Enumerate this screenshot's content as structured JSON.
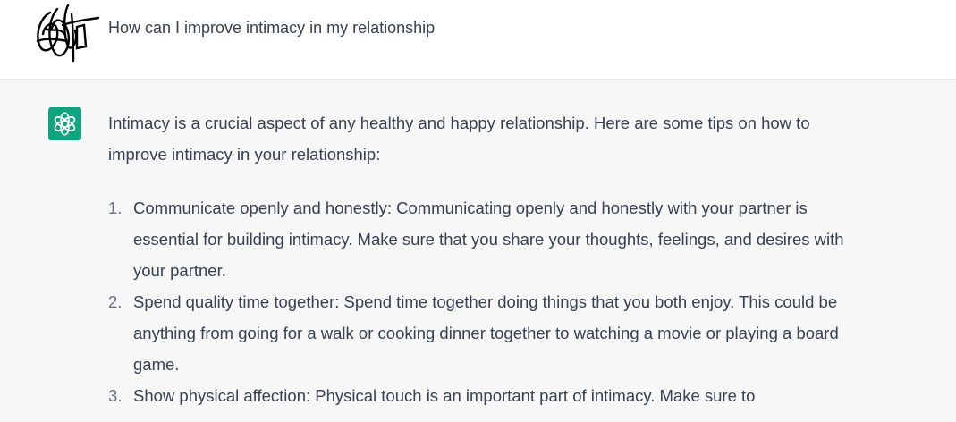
{
  "conversation": {
    "user_message": "How can I improve intimacy in my relationship",
    "assistant": {
      "intro": "Intimacy is a crucial aspect of any healthy and happy relationship. Here are some tips on how to improve intimacy in your relationship:",
      "tips": [
        {
          "number": "1.",
          "text": "Communicate openly and honestly: Communicating openly and honestly with your partner is essential for building intimacy. Make sure that you share your thoughts, feelings, and desires with your partner."
        },
        {
          "number": "2.",
          "text": "Spend quality time together: Spend time together doing things that you both enjoy. This could be anything from going for a walk or cooking dinner together to watching a movie or playing a board game."
        },
        {
          "number": "3.",
          "text": "Show physical affection: Physical touch is an important part of intimacy. Make sure to"
        }
      ]
    }
  },
  "icons": {
    "user_avatar": "scribble-avatar-icon",
    "assistant_avatar": "openai-logo-icon"
  },
  "colors": {
    "assistant_bg": "#f7f7f8",
    "logo_bg": "#10a37f",
    "text": "#374151"
  }
}
